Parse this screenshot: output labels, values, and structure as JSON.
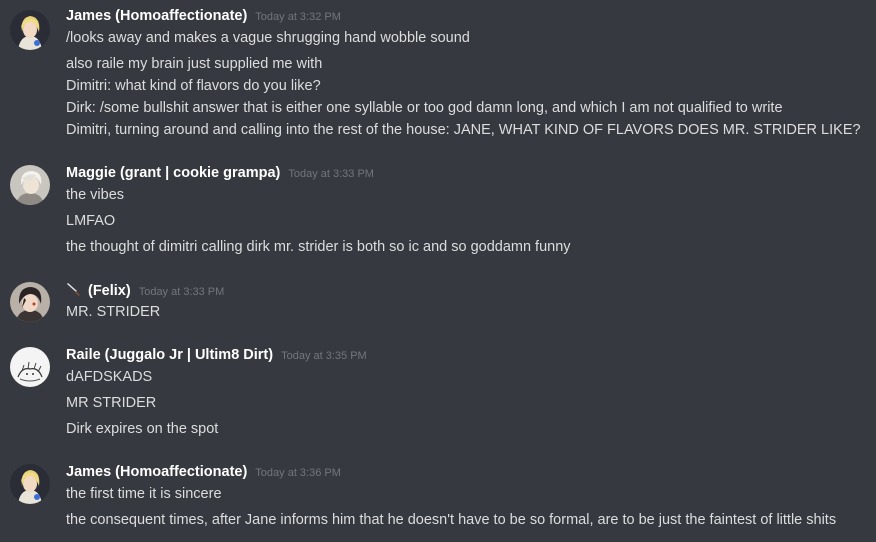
{
  "colors": {
    "background": "#36393f",
    "username": "#ffffff",
    "message_text": "#dcddde",
    "timestamp": "#72767d"
  },
  "messages": [
    {
      "username": "James (Homoaffectionate)",
      "timestamp": "Today at 3:32 PM",
      "avatar": "anime-blonde-avatar",
      "lines": [
        "/looks away and makes a vague shrugging hand wobble sound",
        "also raile my brain just supplied me with",
        "Dimitri: what kind of flavors do you like?",
        "Dirk: /some bullshit answer that is either one syllable or too god damn long, and which I am not qualified to write",
        "Dimitri, turning around and calling into the rest of the house: JANE, WHAT KIND OF FLAVORS DOES MR. STRIDER LIKE?"
      ]
    },
    {
      "username": "Maggie (grant | cookie grampa)",
      "timestamp": "Today at 3:33 PM",
      "avatar": "anime-whitehair-avatar",
      "lines": [
        "the vibes",
        "LMFAO",
        "the thought of dimitri calling dirk mr. strider is both so ic and so goddamn funny"
      ]
    },
    {
      "username": "(Felix)",
      "username_icon": "knife-icon",
      "timestamp": "Today at 3:33 PM",
      "avatar": "anime-darkhair-avatar",
      "lines": [
        "MR. STRIDER"
      ]
    },
    {
      "username": "Raile (Juggalo Jr | Ultim8 Dirt)",
      "timestamp": "Today at 3:35 PM",
      "avatar": "sketch-avatar",
      "lines": [
        "dAFDSKADS",
        "MR STRIDER",
        "Dirk expires on the spot"
      ]
    },
    {
      "username": "James (Homoaffectionate)",
      "timestamp": "Today at 3:36 PM",
      "avatar": "anime-blonde-avatar",
      "lines": [
        "the first time it is sincere",
        "the consequent times, after Jane informs him that he doesn't have to be so formal, are to be just the faintest of little shits"
      ]
    }
  ]
}
